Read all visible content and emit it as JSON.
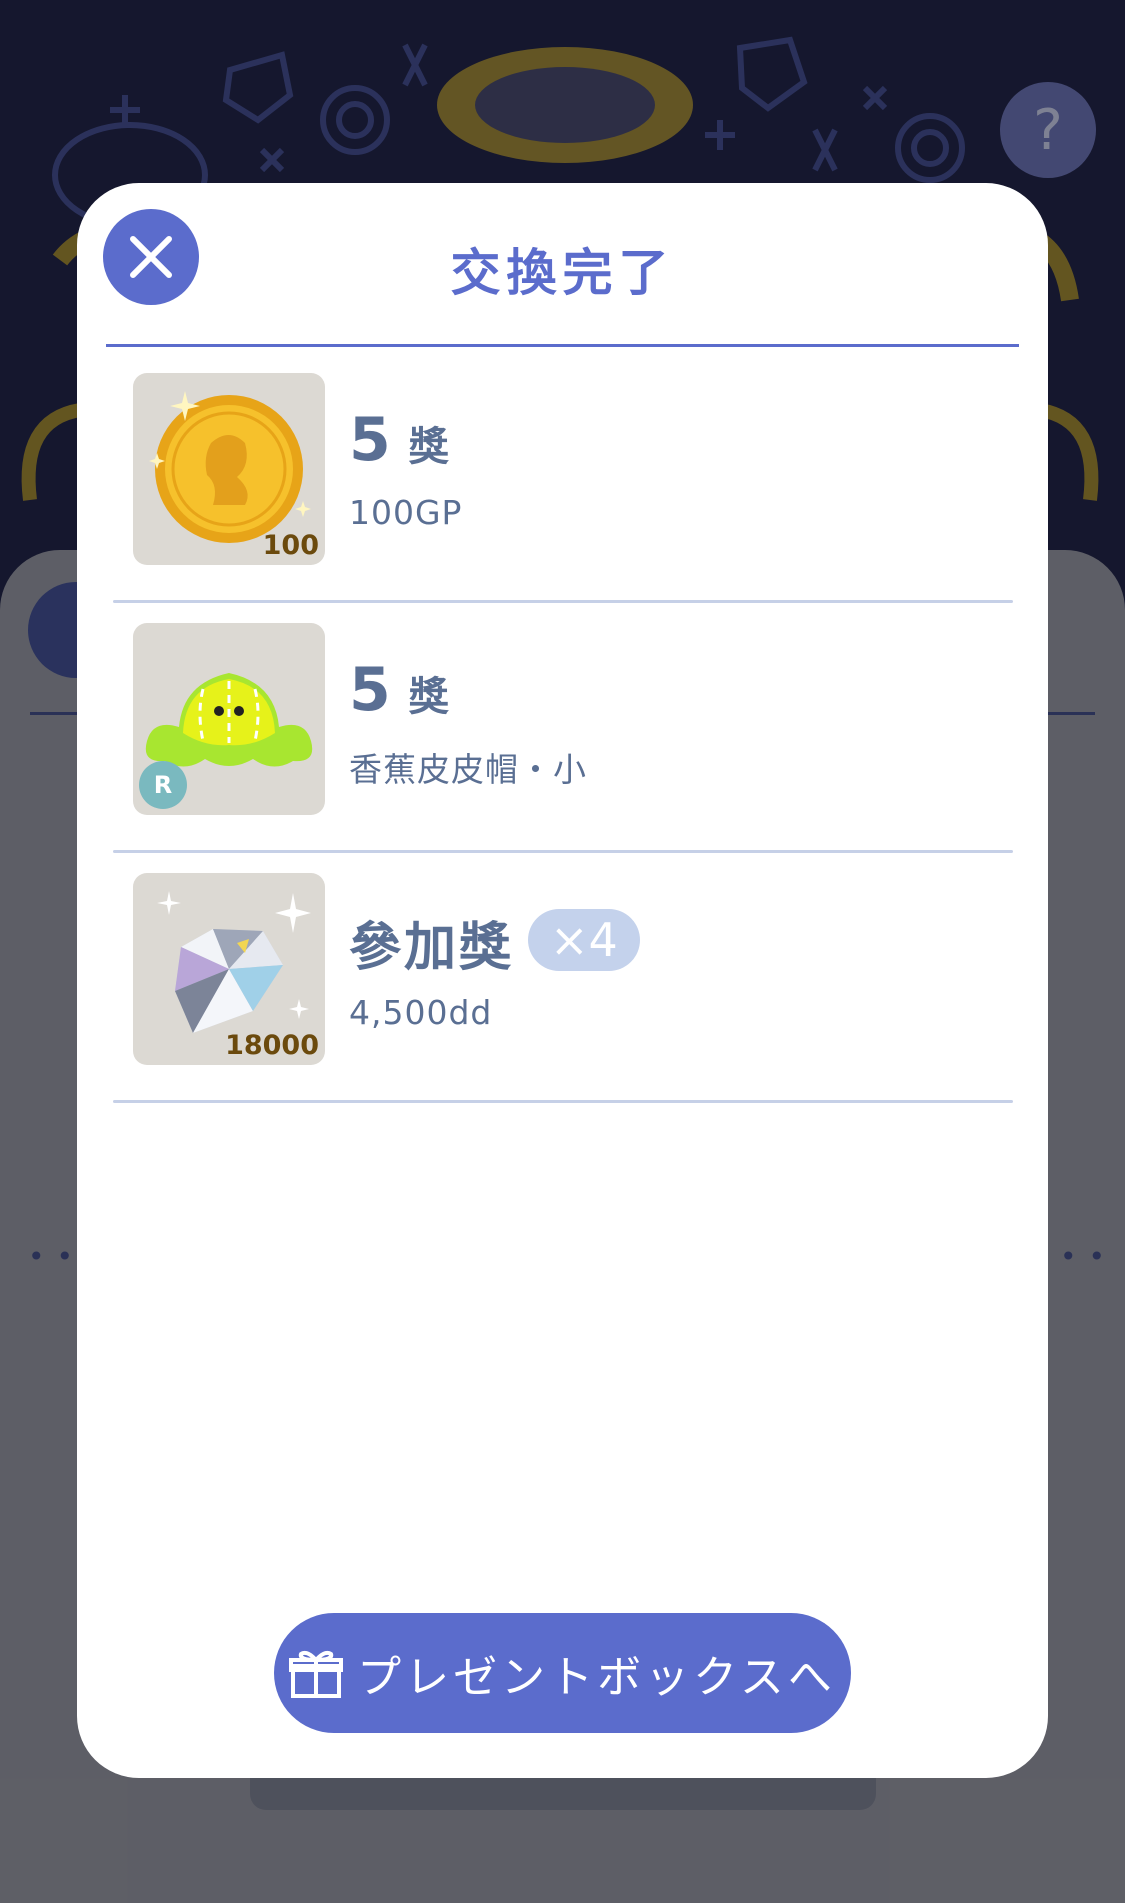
{
  "colors": {
    "accent": "#5b6ccc",
    "text": "#5a6f93",
    "divider": "#c6d0e7",
    "badge": "#c4d2ec"
  },
  "background": {
    "help_icon": "question-icon",
    "help_label": "?"
  },
  "modal": {
    "title": "交換完了",
    "close_icon": "close-icon",
    "items": [
      {
        "icon": "gold-coin",
        "thumb_qty": "100",
        "rank": "5",
        "unit": "獎",
        "desc": "100GP"
      },
      {
        "icon": "banana-peel-hat",
        "rarity": "R",
        "rank": "5",
        "unit": "獎",
        "desc": "香蕉皮皮帽・小"
      },
      {
        "icon": "diamond",
        "thumb_qty": "18000",
        "rank_label": "參加獎",
        "badge": "×4",
        "desc": "4,500dd"
      }
    ],
    "present_button": {
      "icon": "gift-box-icon",
      "label": "プレゼントボックスへ"
    }
  }
}
